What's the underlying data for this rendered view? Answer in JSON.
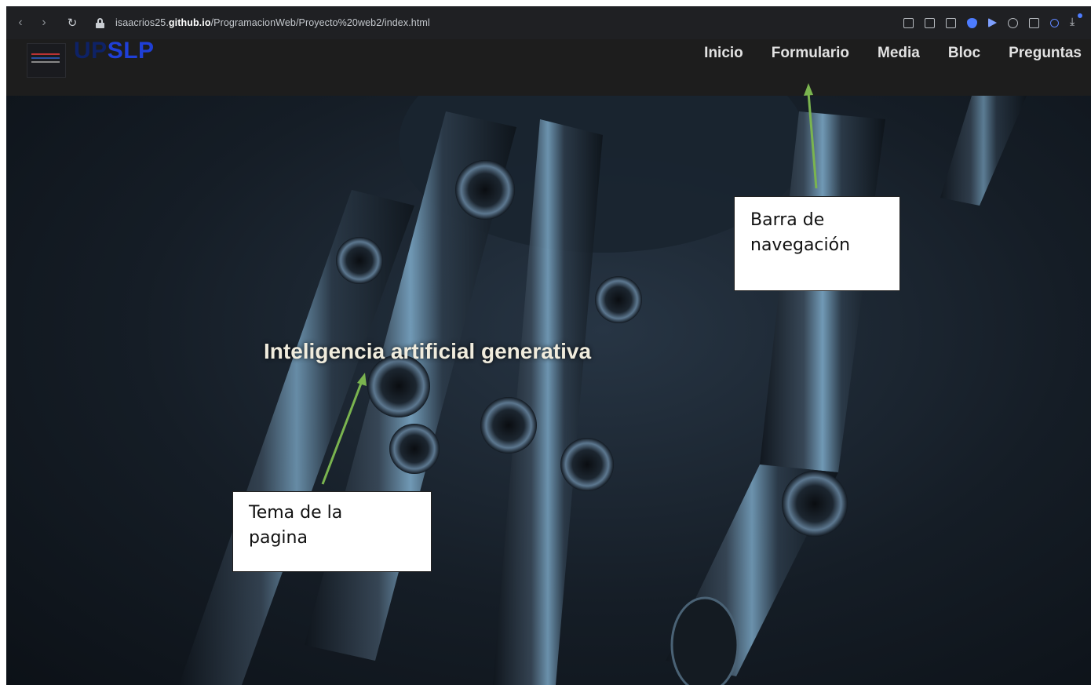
{
  "browser": {
    "url_prefix": "isaacrios25.",
    "url_domain": "github.io",
    "url_path": "/ProgramacionWeb/Proyecto%20web2/index.html",
    "icons": [
      "back-icon",
      "forward-icon",
      "reload-icon",
      "lock-icon",
      "reader-icon",
      "edit-icon",
      "camera-icon",
      "shield-icon",
      "play-icon",
      "heart-icon",
      "cube-icon",
      "user-icon",
      "download-icon"
    ]
  },
  "site": {
    "brand_up": "UP",
    "brand_slp": "SLP",
    "menu": [
      "Inicio",
      "Formulario",
      "Media",
      "Bloc",
      "Preguntas"
    ],
    "hero_title": "Inteligencia artificial generativa"
  },
  "annotations": {
    "nav_label_line1": "Barra de",
    "nav_label_line2": "navegación",
    "tema_label_line1": "Tema de la",
    "tema_label_line2": "pagina"
  },
  "colors": {
    "arrow": "#7ab44f",
    "brand_up": "#0e2266",
    "brand_slp": "#1f3fd6",
    "chrome_bg": "#1f2023",
    "site_nav_bg": "#1d1d1d"
  }
}
